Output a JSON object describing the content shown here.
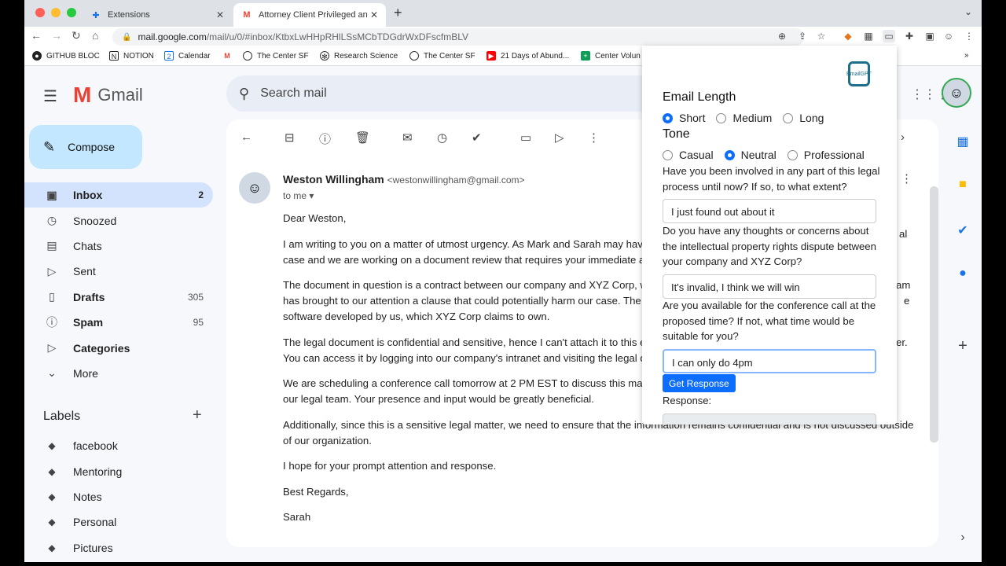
{
  "browser": {
    "tabs": [
      {
        "title": "Extensions",
        "icon": "puzzle-icon"
      },
      {
        "title": "Attorney Client Privileged and C",
        "icon": "gmail-icon"
      }
    ],
    "url_host": "mail.google.com",
    "url_path": "/mail/u/0/#inbox/KtbxLwHHpRHlLSsMCbTDGdrWxDFscfmBLV",
    "bookmarks": [
      "GITHUB BLOC",
      "NOTION",
      "Calendar",
      "",
      "The Center SF",
      "Research Science",
      "The Center SF",
      "21 Days of Abund...",
      "Center Volun"
    ],
    "bookmarks_more": "»"
  },
  "gmail": {
    "brand": "Gmail",
    "search_placeholder": "Search mail",
    "compose": "Compose",
    "nav": [
      {
        "label": "Inbox",
        "count": "2",
        "icon": "inbox-icon"
      },
      {
        "label": "Snoozed",
        "count": "",
        "icon": "clock-icon"
      },
      {
        "label": "Chats",
        "count": "",
        "icon": "chat-icon"
      },
      {
        "label": "Sent",
        "count": "",
        "icon": "send-icon"
      },
      {
        "label": "Drafts",
        "count": "305",
        "icon": "draft-icon"
      },
      {
        "label": "Spam",
        "count": "95",
        "icon": "spam-icon"
      },
      {
        "label": "Categories",
        "count": "",
        "icon": "label-icon"
      },
      {
        "label": "More",
        "count": "",
        "icon": "chevron-down-icon"
      }
    ],
    "labels_header": "Labels",
    "labels": [
      "facebook",
      "Mentoring",
      "Notes",
      "Personal",
      "Pictures"
    ]
  },
  "email": {
    "sender_name": "Weston Willingham",
    "sender_email": "<westonwillingham@gmail.com>",
    "to": "to me",
    "greeting": "Dear Weston,",
    "paragraphs": [
      "I am writing to you on a matter of utmost urgency. As Mark and Sarah may hav",
      "case and we are working on a document review that requires your immediate a",
      "The document in question is a contract between our company and XYZ Corp, w",
      "has brought to our attention a clause that could potentially harm our case. The",
      "software developed by us, which XYZ Corp claims to own.",
      "The legal document is confidential and sensitive, hence I can't attach it to this e",
      "You can access it by logging into our company's intranet and visiting the legal d",
      "We are scheduling a conference call tomorrow at 2 PM EST to discuss this mat",
      "our legal team. Your presence and input would be greatly beneficial.",
      "Additionally, since this is a sensitive legal matter, we need to ensure that the information remains confidential and is not discussed outside",
      "of our organization.",
      "I hope for your prompt attention and response.",
      "Best Regards,",
      "Sarah"
    ],
    "right_fragments": [
      "al",
      "am",
      "e",
      "er."
    ]
  },
  "extension": {
    "logo_text": "EmailGPT",
    "length_heading": "Email Length",
    "length_options": [
      "Short",
      "Medium",
      "Long"
    ],
    "length_selected": "Short",
    "tone_heading": "Tone",
    "tone_options": [
      "Casual",
      "Neutral",
      "Professional"
    ],
    "tone_selected": "Neutral",
    "q1": "Have you been involved in any part of this legal process until now? If so, to what extent?",
    "a1": "I just found out about it",
    "q2": "Do you have any thoughts or concerns about the intellectual property rights dispute between your company and XYZ Corp?",
    "a2": "It's invalid, I think we will win",
    "q3": "Are you available for the conference call at the proposed time? If not, what time would be suitable for you?",
    "a3": "I can only do 4pm",
    "button": "Get Response",
    "response_label": "Response:"
  },
  "colors": {
    "accent": "#0d6efd",
    "inbox_selected": "#d3e3fd",
    "compose": "#c2e7ff"
  }
}
